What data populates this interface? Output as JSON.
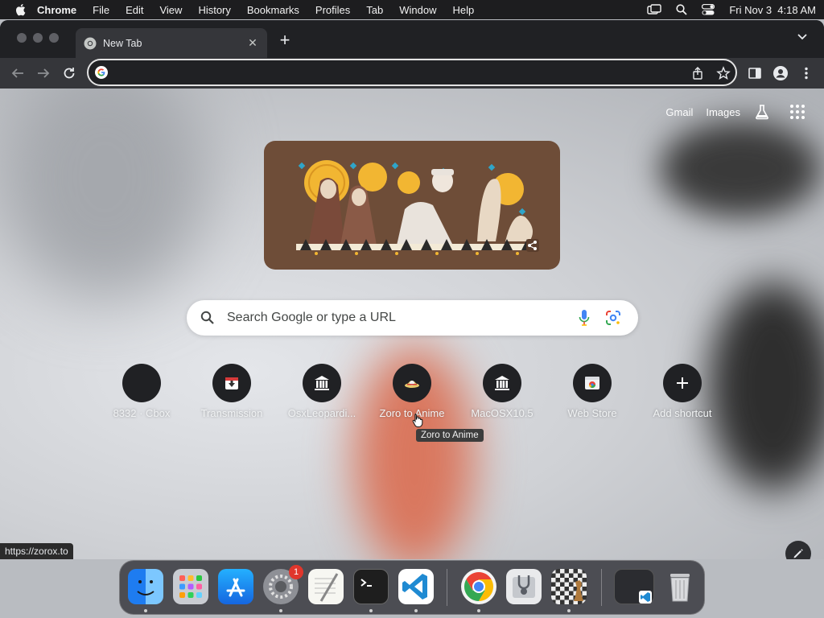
{
  "menubar": {
    "app_name": "Chrome",
    "items": [
      "File",
      "Edit",
      "View",
      "History",
      "Bookmarks",
      "Profiles",
      "Tab",
      "Window",
      "Help"
    ],
    "clock": "Fri Nov 3  4:18 AM",
    "icons": [
      "apple-icon",
      "screen-mirroring-icon",
      "spotlight-search-icon",
      "control-center-icon"
    ]
  },
  "tab": {
    "title": "New Tab",
    "favicon": "chrome-icon"
  },
  "toolbar": {
    "icons": [
      "back-icon",
      "forward-icon",
      "reload-icon",
      "share-icon",
      "bookmark-star-icon",
      "side-panel-icon",
      "profile-icon",
      "menu-icon"
    ],
    "address_value": ""
  },
  "ntp": {
    "top_links": {
      "gmail": "Gmail",
      "images": "Images"
    },
    "search_placeholder": "Search Google or type a URL",
    "shortcuts": [
      {
        "label": "8332 · Cbox"
      },
      {
        "label": "Transmission"
      },
      {
        "label": "OsxLeopardi..."
      },
      {
        "label": "Zoro to Anime"
      },
      {
        "label": "MacOSX10.5"
      },
      {
        "label": "Web Store"
      },
      {
        "label": "Add shortcut"
      }
    ],
    "tooltip": "Zoro to Anime",
    "status_url": "https://zorox.to"
  },
  "dock": {
    "apps": [
      "Finder",
      "Launchpad",
      "App Store",
      "System Settings",
      "TextEdit",
      "Terminal",
      "Visual Studio Code",
      "Google Chrome",
      "Disk Utility",
      "Chess",
      "Minimized Window",
      "Trash"
    ],
    "settings_badge": "1"
  },
  "colors": {
    "menubar_bg": "#1d1d1f",
    "tabstrip_bg": "#202124",
    "toolbar_bg": "#35363a",
    "doodle_bg": "#6e4d38",
    "badge_red": "#e0362c"
  }
}
